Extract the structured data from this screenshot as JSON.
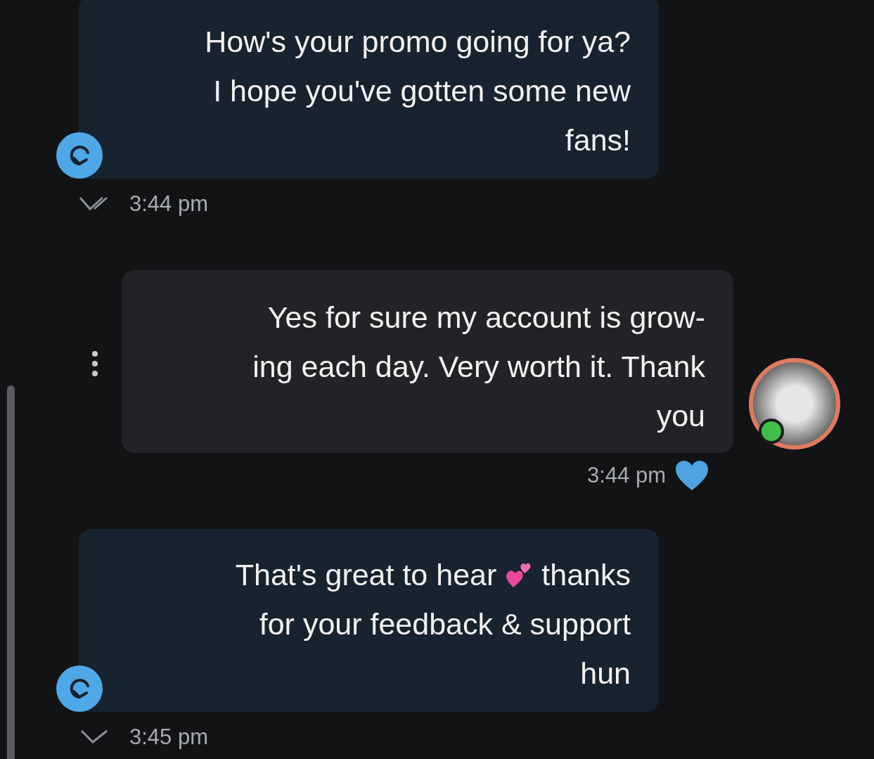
{
  "messages": [
    {
      "kind": "outgoing",
      "lines": [
        [
          {
            "kind": "text",
            "text": "How's your promo going for ya?"
          }
        ],
        [
          {
            "kind": "text",
            "text": "I hope you've gotten some new"
          }
        ],
        [
          {
            "kind": "text",
            "text": "fans!"
          }
        ]
      ],
      "time": "3:44 pm",
      "read": true
    },
    {
      "kind": "incoming",
      "lines": [
        [
          {
            "kind": "text",
            "text": "Yes for sure my account is grow-"
          }
        ],
        [
          {
            "kind": "text",
            "text": "ing each day. Very worth it. Thank"
          }
        ],
        [
          {
            "kind": "text",
            "text": "you"
          }
        ]
      ],
      "time": "3:44 pm",
      "liked": true,
      "online": true
    },
    {
      "kind": "outgoing",
      "lines": [
        [
          {
            "kind": "text",
            "text": "That's great to hear"
          },
          {
            "kind": "hearts"
          },
          {
            "kind": "text",
            "text": "thanks"
          }
        ],
        [
          {
            "kind": "text",
            "text": "for your feedback & support"
          }
        ],
        [
          {
            "kind": "text",
            "text": "hun"
          }
        ]
      ],
      "time": "3:45 pm",
      "read": false
    }
  ]
}
